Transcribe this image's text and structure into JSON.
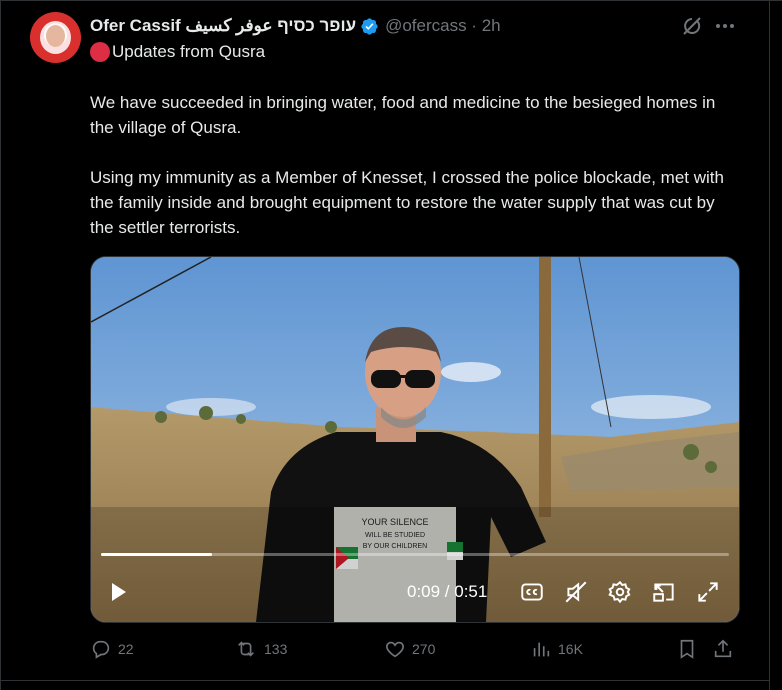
{
  "tweet": {
    "author_name": "Ofer Cassif עופר כסיף عوفر كسيف",
    "handle_time": "@ofercass · 2h",
    "subtitle": "Updates from Qusra",
    "paragraphs": [
      "We have succeeded in bringing water, food and medicine to the besieged homes in the village of Qusra.",
      "Using my immunity as a Member of Knesset, I crossed the police blockade, met with the family inside and brought equipment to restore the water supply that was cut by the settler terrorists."
    ]
  },
  "video": {
    "time": "0:09 / 0:51",
    "progress": 0.176,
    "shirt_text": "YOUR SILENCE WILL BE STUDIED BY OUR CHILDREN"
  },
  "actions": {
    "replies": "22",
    "reposts": "133",
    "likes": "270",
    "views": "16K"
  },
  "colors": {
    "background": "#000000",
    "text": "#e7e9ea",
    "muted": "#71767b",
    "verified": "#1d9bf0",
    "border": "#2f3336"
  }
}
